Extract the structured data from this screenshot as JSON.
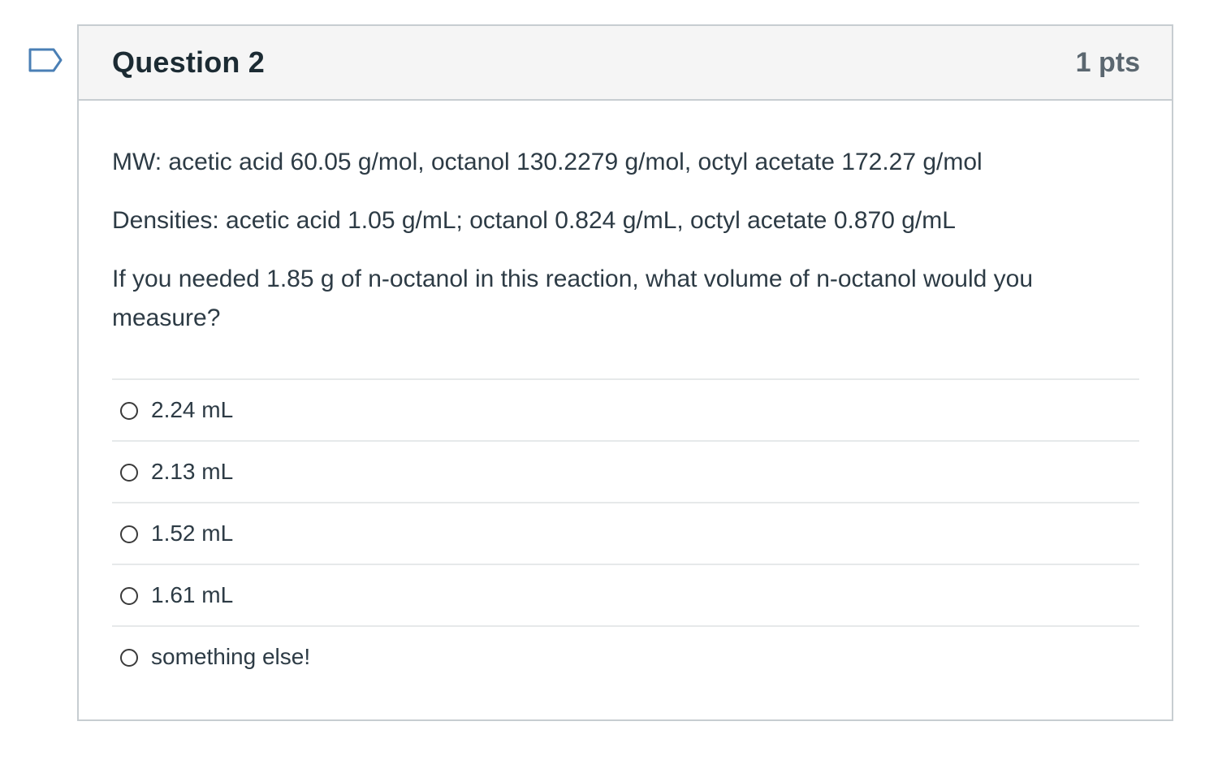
{
  "question": {
    "title": "Question 2",
    "points": "1 pts",
    "flag_icon": "flag-outline-icon",
    "paragraphs": [
      "MW:  acetic acid 60.05 g/mol, octanol 130.2279 g/mol, octyl acetate 172.27 g/mol",
      "Densities: acetic acid 1.05 g/mL; octanol 0.824 g/mL, octyl acetate 0.870 g/mL",
      "If you needed 1.85 g of n-octanol in this reaction, what volume of n-octanol would you measure?"
    ],
    "answers": [
      {
        "label": "2.24 mL"
      },
      {
        "label": "2.13 mL"
      },
      {
        "label": "1.52 mL"
      },
      {
        "label": "1.61 mL"
      },
      {
        "label": "something else!"
      }
    ]
  },
  "colors": {
    "flag_stroke": "#4a7fb5",
    "border": "#c7cdd1",
    "header_bg": "#f5f5f5",
    "text": "#2d3b45"
  }
}
